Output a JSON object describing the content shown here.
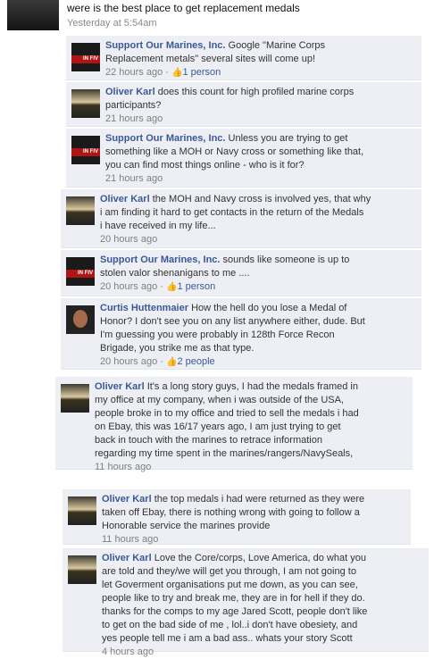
{
  "post": {
    "text": "were is the best place to get replacement medals",
    "time": "Yesterday at 5:54am"
  },
  "comments": [
    {
      "author": "Support Our Marines, Inc.",
      "lines": [
        "Google \"Marine Corps",
        "Replacement metals\" several sites will come up!"
      ],
      "time": "22 hours ago",
      "sep": " · ",
      "likes": "1 person",
      "avatar": "marine"
    },
    {
      "author": "Oliver Karl",
      "lines": [
        "does this count for high profiled marine corps",
        "participants?"
      ],
      "time": "21 hours ago",
      "avatar": "oliver"
    },
    {
      "author": "Support Our Marines, Inc.",
      "lines": [
        "Unless you are trying to get",
        "something like a MOH or Navy cross or something like that,",
        "you can find most things online - who is it for?"
      ],
      "time": "21 hours ago",
      "avatar": "marine"
    },
    {
      "author": "Oliver Karl",
      "lines": [
        "the MOH and Navy cross is involved yes, that why",
        "i am finding it hard to get contacts in the return of the Medals",
        "i have received in my life..."
      ],
      "time": "20 hours ago",
      "avatar": "oliver"
    },
    {
      "author": "Support Our Marines, Inc.",
      "lines": [
        "sounds like someone is up to",
        "stolen valor shenanigans to me ...."
      ],
      "time": "20 hours ago",
      "sep": " · ",
      "likes": "1 person",
      "avatar": "marine"
    },
    {
      "author": "Curtis Huttenmaier",
      "lines": [
        "How the hell do you lose a Medal of",
        "Honor? I don't see you on any list anywhere either, dude. But",
        "I'm guessing you were probably in 128th Force Recon",
        "Brigade, you strike me as that type."
      ],
      "time": "20 hours ago",
      "sep": " · ",
      "likes": "2 people",
      "avatar": "curtis"
    },
    {
      "author": "Oliver Karl",
      "lines": [
        "It's a long story guys, I had the medals framed in",
        "my office at my company, when i was outside of the USA,",
        "people broke in to my office and tried to sell the medals i had",
        "on Ebay, this was 16/17 years ago, I am just trying to get",
        "back in touch with the marines to retrace information",
        "regarding my time spent in the marines/rangers/NavySeals,"
      ],
      "time": "11 hours ago",
      "avatar": "oliver"
    },
    {
      "author": "Oliver Karl",
      "lines": [
        "the top medals i had were returned as they were",
        "taken off Ebay, there is nothing wrong with going to follow a",
        "Honorable service the marines provide"
      ],
      "time": "11 hours ago",
      "avatar": "oliver"
    },
    {
      "author": "Oliver Karl",
      "lines": [
        "Love the Core/corps, Love America, do what you",
        "are told and they/we will get you through, I am not going to",
        "let Goverment organisations put me down, as you can see,",
        "people like to try and break me, they are in for hell if they do.",
        "thanks for the comps to my age Jared Scott, people don't like",
        "to get on the bad side of me , lol..i don't have obesiety, and",
        "yes people tell me i am a bad ass.. whats your story Scott"
      ],
      "time": "4 hours ago",
      "avatar": "oliver"
    }
  ],
  "avatar_text": "IN FIV"
}
